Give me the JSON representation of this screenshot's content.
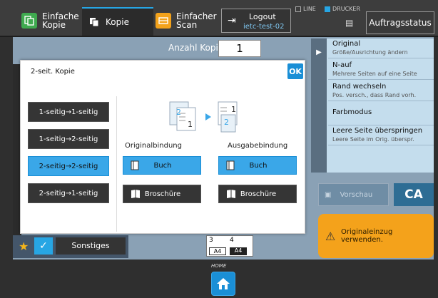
{
  "header": {
    "tabs": [
      {
        "line1": "Einfache",
        "line2": "Kopie"
      },
      {
        "label": "Kopie"
      },
      {
        "line1": "Einfacher",
        "line2": "Scan"
      }
    ],
    "logout": {
      "label": "Logout",
      "user": "ietc-test-02"
    },
    "line_label": "LINE",
    "printer_label": "DRUCKER",
    "job_status_label": "Auftragsstatus"
  },
  "copies": {
    "label": "Anzahl Kopien",
    "value": "1"
  },
  "right_panel": {
    "items": [
      {
        "title": "Original",
        "subtitle": "Größe/Ausrichtung ändern"
      },
      {
        "title": "N-auf",
        "subtitle": "Mehrere Seiten auf eine Seite"
      },
      {
        "title": "Rand wechseln",
        "subtitle": "Pos. versch., dass Rand vorh."
      },
      {
        "title": "Farbmodus",
        "subtitle": ""
      },
      {
        "title": "Leere Seite überspringen",
        "subtitle": "Leere Seite im Orig. überspr."
      }
    ],
    "preview_label": "Vorschau",
    "ca_label": "CA",
    "alert_text_1": "Originaleinzug",
    "alert_text_2": "verwenden."
  },
  "bottom": {
    "other_label": "Sonstiges",
    "tray_3": "3",
    "tray_4": "4",
    "size_1": "A4",
    "size_2": "A4",
    "home_label": "HOME"
  },
  "dialog": {
    "title": "2-seit. Kopie",
    "ok_label": "OK",
    "modes": [
      {
        "label": "1-seitig→1-seitig",
        "selected": false
      },
      {
        "label": "1-seitig→2-seitig",
        "selected": false
      },
      {
        "label": "2-seitig→2-seitig",
        "selected": true
      },
      {
        "label": "2-seitig→1-seitig",
        "selected": false
      }
    ],
    "illus_front": "2",
    "illus_back": "1",
    "illus_out_front": "1",
    "illus_out_back": "2",
    "original_binding_label": "Originalbindung",
    "output_binding_label": "Ausgabebindung",
    "book_label": "Buch",
    "brochure_label": "Broschüre"
  },
  "colors": {
    "accent": "#27a6e4",
    "selected": "#3aa7e8",
    "alert": "#f4a21b"
  }
}
